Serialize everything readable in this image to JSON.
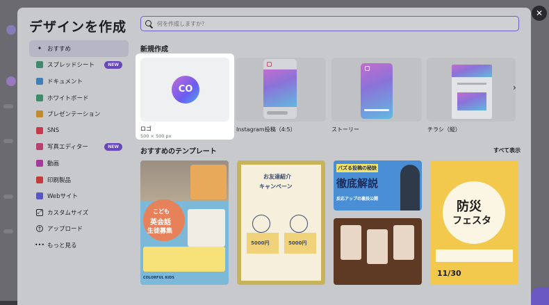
{
  "modal": {
    "title": "デザインを作成",
    "close_icon": "close-icon"
  },
  "search": {
    "placeholder": "何を作成しますか？"
  },
  "sidebar": {
    "items": [
      {
        "label": "おすすめ",
        "icon": "sparkle-icon",
        "active": true
      },
      {
        "label": "スプレッドシート",
        "icon": "spreadsheet-icon",
        "badge": "NEW"
      },
      {
        "label": "ドキュメント",
        "icon": "document-icon"
      },
      {
        "label": "ホワイトボード",
        "icon": "whiteboard-icon"
      },
      {
        "label": "プレゼンテーション",
        "icon": "presentation-icon"
      },
      {
        "label": "SNS",
        "icon": "heart-icon"
      },
      {
        "label": "写真エディター",
        "icon": "photo-icon",
        "badge": "NEW"
      },
      {
        "label": "動画",
        "icon": "video-icon"
      },
      {
        "label": "印刷製品",
        "icon": "print-icon"
      },
      {
        "label": "Webサイト",
        "icon": "website-icon"
      },
      {
        "label": "カスタムサイズ",
        "icon": "custom-size-icon"
      },
      {
        "label": "アップロード",
        "icon": "upload-icon"
      },
      {
        "label": "もっと見る",
        "icon": "more-icon"
      }
    ]
  },
  "create_section": {
    "title": "新規作成",
    "cards": [
      {
        "label": "ロゴ",
        "size": "500 × 500 px",
        "logo_text": "CO"
      },
      {
        "label": "Instagram投稿（4:5）"
      },
      {
        "label": "ストーリー"
      },
      {
        "label": "チラシ（縦）"
      }
    ]
  },
  "templates_section": {
    "title": "おすすめのテンプレート",
    "see_all": "すべて表示",
    "cards": [
      {
        "name": "kids-english-flyer",
        "lines": [
          "こども",
          "英会話",
          "生徒募集",
          "COLORFUL KIDS"
        ]
      },
      {
        "name": "referral-campaign-flyer",
        "lines": [
          "お友達紹介",
          "キャンペーン",
          "5000円",
          "5000円"
        ]
      },
      {
        "name": "buzz-post-thumbnail",
        "lines": [
          "バズる投稿の秘訣",
          "徹底解説",
          "反応アップの裏技公開"
        ]
      },
      {
        "name": "disaster-festa-poster",
        "lines": [
          "防災",
          "フェスタ",
          "11/30"
        ]
      }
    ]
  },
  "colors": {
    "accent": "#6b5ed0",
    "badge": "#6747b9"
  }
}
